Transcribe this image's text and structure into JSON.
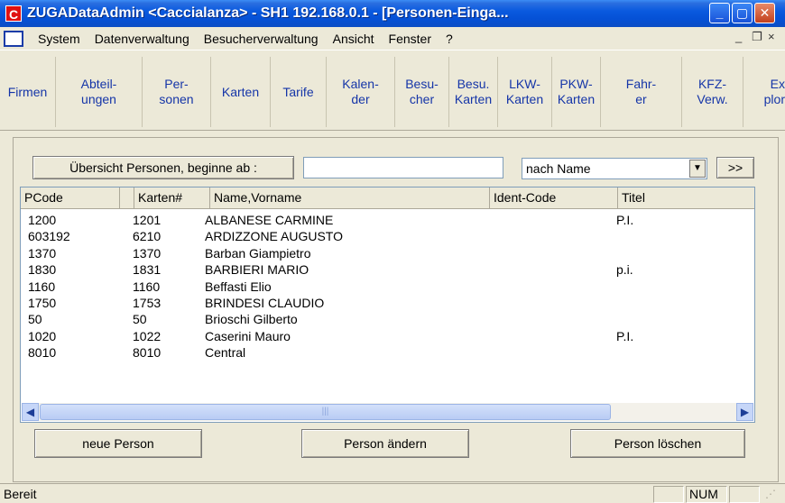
{
  "window": {
    "app_icon": "C",
    "title": "ZUGADataAdmin <Caccialanza> - SH1 192.168.0.1 - [Personen-Einga...",
    "accent": "#0a5adf"
  },
  "menubar": {
    "items": [
      "System",
      "Datenverwaltung",
      "Besucherverwaltung",
      "Ansicht",
      "Fenster",
      "?"
    ],
    "mdi_min": "_",
    "mdi_restore": "❐",
    "mdi_close": "×"
  },
  "toolbar": {
    "firmen": "Firmen",
    "abteilungen": "Abteil-\nungen",
    "personen": "Per-\nsonen",
    "karten": "Karten",
    "tarife": "Tarife",
    "kalender": "Kalen-\nder",
    "besucher": "Besu-\ncher",
    "besu_karten": "Besu.\nKarten",
    "lkw_karten": "LKW-\nKarten",
    "pkw_karten": "PKW-\nKarten",
    "fahrer": "Fahr-\ner",
    "kfz_verw": "KFZ-\nVerw.",
    "explorer": "Ex\nplor"
  },
  "search": {
    "button_label": "Übersicht Personen, beginne ab :",
    "value": "",
    "sort_selected": "nach Name",
    "go_label": ">>"
  },
  "list": {
    "columns": [
      "PCode",
      "Karten#",
      "Name,Vorname",
      "Ident-Code",
      "Titel"
    ],
    "rows": [
      {
        "pcode": "1200",
        "karten": "1201",
        "name": "ALBANESE CARMINE",
        "ident": "",
        "titel": "P.I."
      },
      {
        "pcode": "603192",
        "karten": "6210",
        "name": "ARDIZZONE AUGUSTO",
        "ident": "",
        "titel": ""
      },
      {
        "pcode": "1370",
        "karten": "1370",
        "name": "Barban Giampietro",
        "ident": "",
        "titel": ""
      },
      {
        "pcode": "1830",
        "karten": "1831",
        "name": "BARBIERI MARIO",
        "ident": "",
        "titel": "p.i."
      },
      {
        "pcode": "1160",
        "karten": "1160",
        "name": "Beffasti Elio",
        "ident": "",
        "titel": ""
      },
      {
        "pcode": "1750",
        "karten": "1753",
        "name": "BRINDESI CLAUDIO",
        "ident": "",
        "titel": ""
      },
      {
        "pcode": "50",
        "karten": "50",
        "name": "Brioschi Gilberto",
        "ident": "",
        "titel": ""
      },
      {
        "pcode": "1020",
        "karten": "1022",
        "name": "Caserini Mauro",
        "ident": "",
        "titel": "P.I."
      },
      {
        "pcode": "8010",
        "karten": "8010",
        "name": "Central",
        "ident": "",
        "titel": ""
      }
    ]
  },
  "actions": {
    "new": "neue Person",
    "edit": "Person ändern",
    "delete": "Person löschen"
  },
  "statusbar": {
    "text": "Bereit",
    "num": "NUM"
  }
}
